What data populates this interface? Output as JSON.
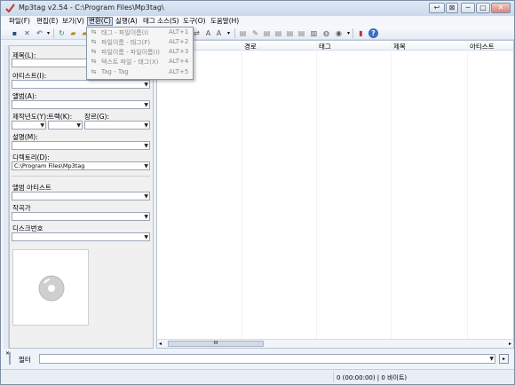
{
  "window": {
    "title": "Mp3tag v2.54  -  C:\\Program Files\\Mp3tag\\",
    "buttons": {
      "extra1": "↩",
      "extra2": "⊠",
      "minimize": "─",
      "maximize": "□",
      "close": "✕"
    }
  },
  "menu": [
    {
      "label": "파일(F)"
    },
    {
      "label": "편집(E)"
    },
    {
      "label": "보기(V)"
    },
    {
      "label": "변환(C)"
    },
    {
      "label": "실행(A)"
    },
    {
      "label": "태그 소스(S)"
    },
    {
      "label": "도구(O)"
    },
    {
      "label": "도움말(H)"
    }
  ],
  "dropdown": {
    "items": [
      {
        "label": "태그 - 파일이름(I)",
        "shortcut": "ALT+1"
      },
      {
        "label": "파일이름 - 태그(F)",
        "shortcut": "ALT+2"
      },
      {
        "label": "파일이름 - 파일이름(I)",
        "shortcut": "ALT+3"
      },
      {
        "label": "텍스트 파일 - 태그(X)",
        "shortcut": "ALT+4"
      },
      {
        "label": "Tag - Tag",
        "shortcut": "ALT+5"
      }
    ]
  },
  "tag_panel": {
    "title_label": "제목(L):",
    "artist_label": "아티스트(I):",
    "album_label": "앨범(A):",
    "year_label": "제작년도(Y):",
    "track_label": "트랙(K):",
    "genre_label": "장르(G):",
    "comment_label": "설명(M):",
    "directory_label": "디렉토리(D):",
    "directory_value": "C:\\Program Files\\Mp3tag",
    "album_artist_label": "앨범 아티스트",
    "composer_label": "작곡가",
    "disc_label": "디스크번호"
  },
  "file_list": {
    "columns": [
      "경로",
      "태그",
      "제목",
      "아티스트"
    ],
    "scroll_mark": "III"
  },
  "filter": {
    "label": "필터",
    "value": ""
  },
  "status": {
    "text": "0 (00:00:00) | 0 바이트)"
  },
  "colors": {
    "accent": "#4a6a92",
    "window_bg": "#eef3fa"
  }
}
